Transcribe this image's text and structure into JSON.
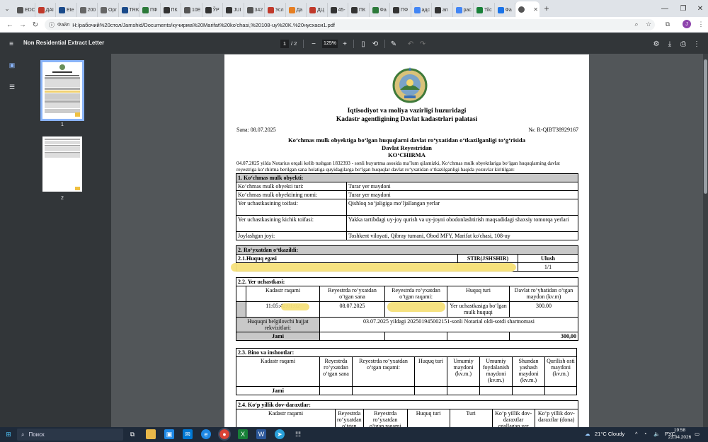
{
  "browser": {
    "tabs": [
      {
        "label": "EDC",
        "icon": "doc-icon",
        "color": "#555"
      },
      {
        "label": "ДАІ",
        "icon": "flag-icon",
        "color": "#c0392b"
      },
      {
        "label": "Ete",
        "icon": "ete-icon",
        "color": "#1a4a8a"
      },
      {
        "label": "200",
        "icon": "grid-icon",
        "color": "#666"
      },
      {
        "label": "Орг",
        "icon": "grid-icon",
        "color": "#666"
      },
      {
        "label": "TRK",
        "icon": "trk-icon",
        "color": "#1a4a8a"
      },
      {
        "label": "ПФ",
        "icon": "pf-icon",
        "color": "#2c7a3a"
      },
      {
        "label": "ПК",
        "icon": "globe-icon",
        "color": "#333"
      },
      {
        "label": "10Е",
        "icon": "star-icon",
        "color": "#555"
      },
      {
        "label": "ЎР",
        "icon": "globe-icon",
        "color": "#333"
      },
      {
        "label": "JUI",
        "icon": "globe-icon",
        "color": "#333"
      },
      {
        "label": "342",
        "icon": "star-icon",
        "color": "#555"
      },
      {
        "label": "Усл",
        "icon": "flag-icon",
        "color": "#c0392b"
      },
      {
        "label": "Да",
        "icon": "da-icon",
        "color": "#e67e22"
      },
      {
        "label": "ДЦ",
        "icon": "diamond-icon",
        "color": "#c0392b"
      },
      {
        "label": "45-",
        "icon": "globe-icon",
        "color": "#333"
      },
      {
        "label": "ПК",
        "icon": "globe-icon",
        "color": "#333"
      },
      {
        "label": "Фа",
        "icon": "globe-icon",
        "color": "#2c7a3a"
      },
      {
        "label": "ПФ",
        "icon": "globe-icon",
        "color": "#333"
      },
      {
        "label": "адс",
        "icon": "google-icon",
        "color": "#4285f4"
      },
      {
        "label": "ап",
        "icon": "globe-icon",
        "color": "#333"
      },
      {
        "label": "рас",
        "icon": "google-icon",
        "color": "#4285f4"
      },
      {
        "label": "Tilc",
        "icon": "sheet-icon",
        "color": "#188038"
      },
      {
        "label": "Фа",
        "icon": "globe-icon",
        "color": "#1a73e8"
      }
    ],
    "active_tab_icon": "globe-icon",
    "address_chip": "Файл",
    "url": "H:/рабочий%20стол/Jamshid/Documents/кучирма%20Marifat%20ko'chasi,%20108-uy%20K.%20нусхаси1.pdf",
    "avatar_letter": "J"
  },
  "pdf_viewer": {
    "title": "Non Residential Extract Letter",
    "page_current": "1",
    "page_total": "/  2",
    "zoom": "125%",
    "thumb_labels": [
      "1",
      "2"
    ]
  },
  "document": {
    "header_line1": "Iqtisodiyot va moliya vazirligi huzuridagi",
    "header_line2": "Kadastr agentligining Davlat kadastrlari palatasi",
    "date": "Sana: 08.07.2025",
    "number": "№: R-QIBT38929167",
    "title_line1": "Ko‘chmas mulk obyektiga bo‘lgan huquqlarni davlat ro‘yxatidan o‘tkazilganligi to‘g‘risida",
    "title_line2": "Davlat Reyestridan",
    "title_line3": "KO‘CHIRMA",
    "intro": "04.07.2025 yilda Notarius orqali kelib tushgan 1832393 - sonli buyurtma asosida ma’lum qilamizki, Ko‘chmas mulk obyektlariga bo‘lgan huquqlarning davlat reyestriga ko‘chirma berilgan sana holatiga quyidagilarga bo‘lgan huquqlar davlat ro‘yxatidan o‘tkazilganligi haqida yozuvlar kiritilgan:",
    "sec1": {
      "heading": "1. Ko‘chmas mulk obyekti:",
      "rows": [
        [
          "Ko‘chmas mulk obyekti turi:",
          "Turar yer maydoni"
        ],
        [
          "Ko‘chmas mulk obyektining nomi:",
          "Turar yer maydoni"
        ],
        [
          "Yer uchastkasining toifasi:",
          "Qishloq xo‘jaligiga mo‘ljallangan yerlar"
        ],
        [
          "Yer uchastkasining kichik toifasi:",
          "Yakka tartibdagi uy-joy qurish va uy-joyni obodonlashtirish maqsadidagi shaxsiy tomorqa yerlari"
        ],
        [
          "Joylashgan joyi:",
          "Toshkent viloyati, Qibray tumani, Obod MFY, Marifat ko'chasi, 108-uy"
        ]
      ]
    },
    "sec2": {
      "heading": "2. Ro‘yxatdan o‘tkazildi:",
      "owner_heading": "2.1.Huquq egasi",
      "stir_heading": "STIR(JSHSHIR)",
      "ulush_heading": "Ulush",
      "ulush_value": "1/1",
      "land_heading": "2.2. Yer uchastkasi:",
      "land_cols": [
        "Kadastr raqami",
        "Reyestrda ro‘yxatdan o‘tgan sana",
        "Reyestrda ro‘yxatdan o‘tgan raqami:",
        "Huquq turi",
        "Davlat ro‘yhatidan o‘tgan maydon (kv.m)"
      ],
      "land_row": [
        "11:05:42:01:02",
        "08.07.2025",
        "",
        "Yer uchastkasiga bo‘lgan mulk huquqi",
        "300.00"
      ],
      "doc_label": "Huquqni belgilovchi hujjat rekvizitlari:",
      "doc_value": "03.07.2025 yildagi 202501945002151-sonli Notarial oldi-sotdi shartnomasi",
      "total_label": "Jami",
      "total_value": "300,00"
    },
    "sec23": {
      "heading": "2.3. Bino va inshootlar:",
      "cols": [
        "Kadastr raqami",
        "Reyestrda ro‘yxatdan o‘tgan sana",
        "Reyestrda ro‘yxatdan o‘tgan raqami:",
        "Huquq turi",
        "Umumiy maydoni (kv.m.)",
        "Umumiy foydalanish maydoni (kv.m.)",
        "Shundan yashash maydoni (kv.m.)",
        "Qurilish osti maydoni (kv.m.)"
      ],
      "total_label": "Jami"
    },
    "sec24": {
      "heading": "2.4. Ko‘p yillik dov-daraxtlar:",
      "cols": [
        "Kadastr raqami",
        "Reyestrda ro‘yxatdan o‘tgan sana",
        "Reyestrda ro‘yxatdan o‘tgan raqami",
        "Huquq turi",
        "Turi",
        "Ko‘p yillik dov-daraxtlar egallagan yer",
        "Ko‘p yillik dov-daraxtlar (dona)"
      ]
    }
  },
  "taskbar": {
    "search_placeholder": "Поиск",
    "weather": "21°C  Cloudy",
    "lang": "РУС",
    "time": "19:58",
    "date": "23.04.2026"
  }
}
